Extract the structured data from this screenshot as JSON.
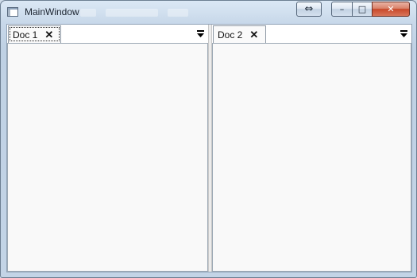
{
  "window": {
    "title": "MainWindow"
  },
  "caption_buttons": [
    {
      "name": "restore-down",
      "glyph": "⇔"
    },
    {
      "name": "minimize",
      "glyph": "–"
    },
    {
      "name": "maximize",
      "glyph": "□"
    },
    {
      "name": "close",
      "glyph": "✕"
    }
  ],
  "panes": [
    {
      "tab_label": "Doc 1",
      "close_glyph": "✕",
      "focused": true
    },
    {
      "tab_label": "Doc 2",
      "close_glyph": "✕",
      "focused": false
    }
  ],
  "colors": {
    "close_accent": "#c8482a",
    "document_background": "#f9f9f9"
  }
}
